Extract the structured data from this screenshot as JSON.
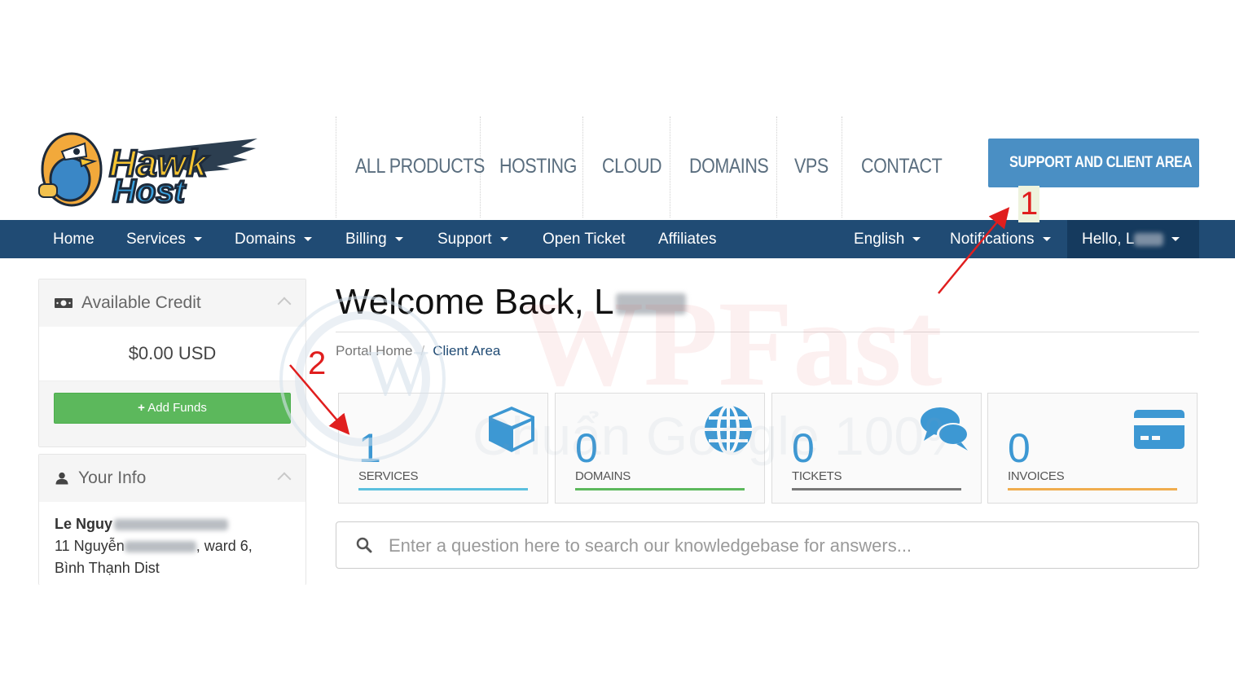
{
  "brand": {
    "logo_text": "HawkHost"
  },
  "top_nav": {
    "items": [
      "ALL PRODUCTS",
      "HOSTING",
      "CLOUD",
      "DOMAINS",
      "VPS",
      "CONTACT"
    ],
    "support_button": "SUPPORT AND CLIENT AREA"
  },
  "main_nav": {
    "home": "Home",
    "services": "Services",
    "domains": "Domains",
    "billing": "Billing",
    "support": "Support",
    "open_ticket": "Open Ticket",
    "affiliates": "Affiliates",
    "language": "English",
    "notifications": "Notifications",
    "hello": "Hello, L"
  },
  "sidebar": {
    "credit": {
      "title": "Available Credit",
      "amount": "$0.00 USD",
      "add_funds": "Add Funds"
    },
    "info": {
      "title": "Your Info",
      "name": "Le Nguy",
      "address_line1_start": "11 Nguyễn",
      "address_line1_end": ", ward 6,",
      "address_line2": "Bình Thạnh Dist"
    }
  },
  "main": {
    "welcome": "Welcome Back, L",
    "breadcrumb": {
      "home": "Portal Home",
      "separator": "/",
      "current": "Client Area"
    },
    "tiles": [
      {
        "count": "1",
        "label": "SERVICES",
        "color": "#5bc0de",
        "icon": "cube-icon"
      },
      {
        "count": "0",
        "label": "DOMAINS",
        "color": "#5cb85c",
        "icon": "globe-icon"
      },
      {
        "count": "0",
        "label": "TICKETS",
        "color": "#777777",
        "icon": "comments-icon"
      },
      {
        "count": "0",
        "label": "INVOICES",
        "color": "#f0ad4e",
        "icon": "credit-card-icon"
      }
    ],
    "kb_search": {
      "placeholder": "Enter a question here to search our knowledgebase for answers..."
    }
  },
  "annotations": {
    "label_1": "1",
    "label_2": "2"
  },
  "watermark": {
    "text": "WPFast",
    "subtext": "Chuẩn Google 100%"
  },
  "colors": {
    "nav_bg": "#204b74",
    "accent": "#3d98d3",
    "support_btn": "#4a8fc4",
    "add_funds": "#5cb85c",
    "annotation": "#e01e1e"
  }
}
